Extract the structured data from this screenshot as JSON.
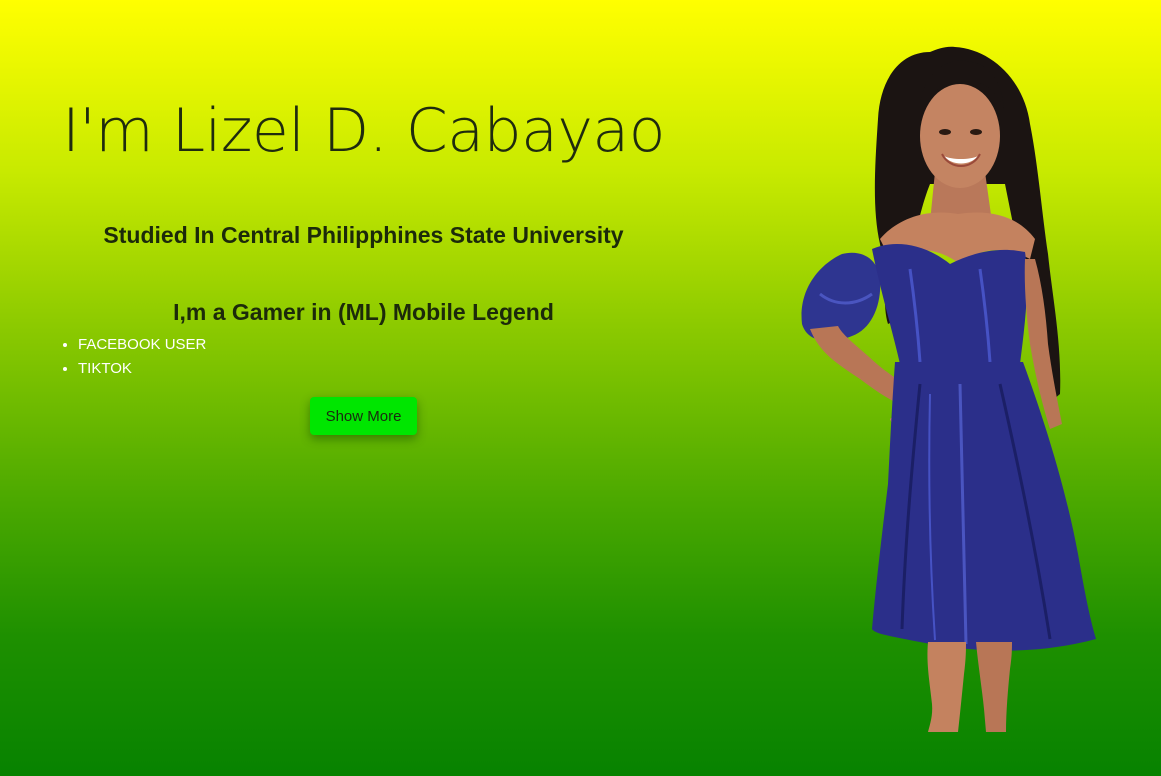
{
  "hero": {
    "title": "I'm Lizel D. Cabayao",
    "education": "Studied In Central Philipphines State University",
    "gamer": "I,m a Gamer in (ML) Mobile Legend"
  },
  "social": {
    "items": [
      "FACEBOOK USER",
      "TIKTOK"
    ]
  },
  "button": {
    "show_more": "Show More"
  },
  "colors": {
    "gradient_top": "#ffff00",
    "gradient_bottom": "#078200",
    "button_bg": "#00e600",
    "dress": "#2b2f8a"
  }
}
